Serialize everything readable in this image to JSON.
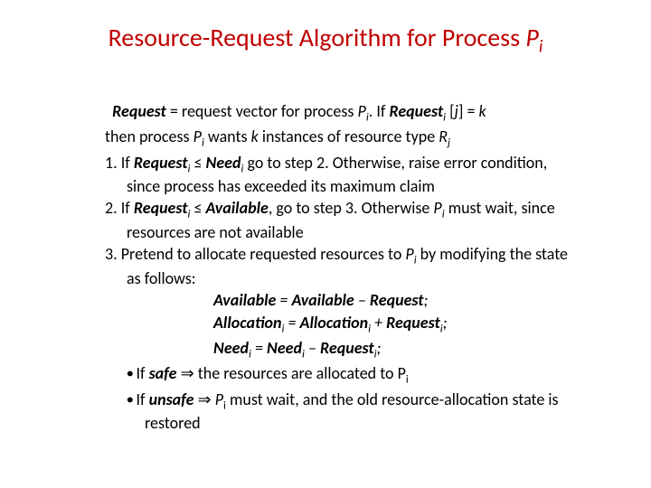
{
  "title": {
    "prefix": "Resource-Request Algorithm for Process ",
    "var": "P",
    "sub": "i"
  },
  "intro": {
    "l1_a": "Request",
    "l1_b": " = request vector for process ",
    "l1_c": "P",
    "l1_d": "i",
    "l1_e": ".  If ",
    "l1_f": "Request",
    "l1_g": "i",
    "l1_h": " [",
    "l1_i": "j",
    "l1_j": "] = ",
    "l1_k": "k",
    "l2_a": "then process ",
    "l2_b": "P",
    "l2_c": "i",
    "l2_d": " wants ",
    "l2_e": "k",
    "l2_f": " instances of resource type ",
    "l2_g": "R",
    "l2_h": "j"
  },
  "s1": {
    "num": "1. ",
    "a": "If ",
    "b": "Request",
    "c": "i",
    "d": " ≤ ",
    "e": "Need",
    "f": "i",
    "g": " go to step 2.  Otherwise, raise error condition, since process has exceeded its maximum claim"
  },
  "s2": {
    "num": "2. ",
    "a": "If ",
    "b": "Request",
    "c": "i",
    "d": " ≤ ",
    "e": "Available",
    "f": ", go to step 3.  Otherwise ",
    "g": "P",
    "h": "i",
    "i": "  must wait, since resources are not available"
  },
  "s3": {
    "num": "3. ",
    "a": "Pretend to allocate requested resources to ",
    "b": "P",
    "c": "i",
    "d": " by modifying the state as follows:"
  },
  "eq1": {
    "a": "Available",
    "b": " = ",
    "c": "Available",
    "d": "  – ",
    "e": "Request",
    "f": ";"
  },
  "eq2": {
    "a": "Allocation",
    "b": "i",
    "c": " = ",
    "d": "Allocation",
    "e": "i",
    "f": " + ",
    "g": "Request",
    "h": "i",
    "i": ";"
  },
  "eq3": {
    "a": "Need",
    "b": "i",
    "c": " = ",
    "d": "Need",
    "e": "i",
    "f": " – ",
    "g": "Request",
    "h": "i",
    "i": ";"
  },
  "b1": {
    "a": "If ",
    "b": "safe",
    "c": " ⇒ the resources are allocated to P",
    "d": "i"
  },
  "b2": {
    "a": "If ",
    "b": "unsafe",
    "c": " ⇒ ",
    "d": "P",
    "e": "i",
    "f": " must wait, and the old resource-allocation state is restored"
  }
}
